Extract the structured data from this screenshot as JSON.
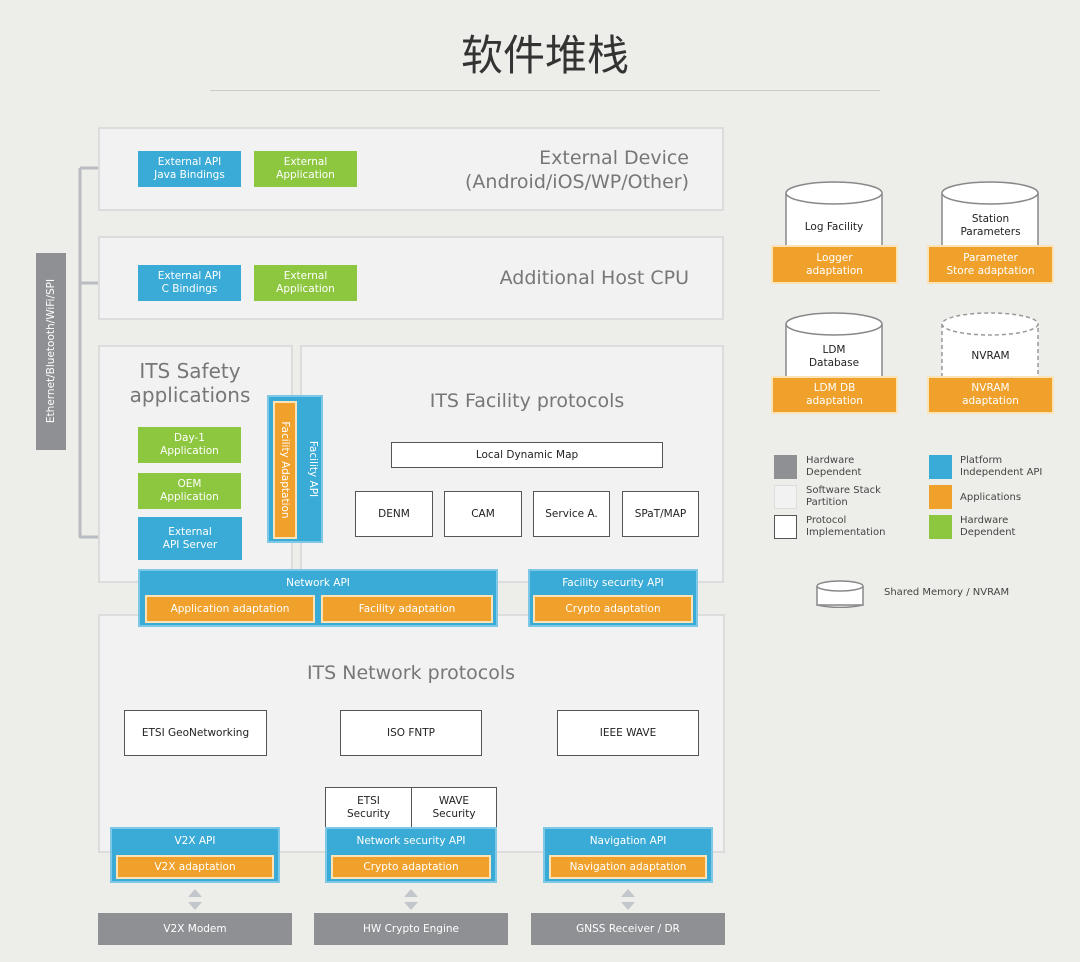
{
  "title": "软件堆栈",
  "side_bar": "Ethernet/Bluetooth/WiFi/SPI",
  "external_device": {
    "title1": "External Device",
    "title2": "(Android/iOS/WP/Other)",
    "api": [
      "External API",
      "Java Bindings"
    ],
    "app": [
      "External",
      "Application"
    ]
  },
  "host_cpu": {
    "title": "Additional Host CPU",
    "api": [
      "External API",
      "C Bindings"
    ],
    "app": [
      "External",
      "Application"
    ]
  },
  "safety": {
    "title1": "ITS Safety",
    "title2": "applications",
    "day1": [
      "Day-1",
      "Application"
    ],
    "oem": [
      "OEM",
      "Application"
    ],
    "server": [
      "External",
      "API Server"
    ]
  },
  "facility": {
    "title": "ITS Facility protocols",
    "api": "Facility API",
    "adaptation": "Facility Adaptation",
    "ldm": "Local Dynamic Map",
    "protocols": [
      "DENM",
      "CAM",
      "Service A.",
      "SPaT/MAP"
    ]
  },
  "network_api": {
    "label": "Network API",
    "items": [
      "Application adaptation",
      "Facility adaptation"
    ]
  },
  "facility_security_api": {
    "label": "Facility security API",
    "item": "Crypto adaptation"
  },
  "network": {
    "title": "ITS Network protocols",
    "protocols": [
      "ETSI GeoNetworking",
      "ISO FNTP",
      "IEEE WAVE"
    ],
    "etsi_sec": [
      "ETSI",
      "Security"
    ],
    "wave_sec": [
      "WAVE",
      "Security"
    ]
  },
  "bottom_apis": [
    {
      "label": "V2X API",
      "item": "V2X adaptation",
      "hw": "V2X Modem"
    },
    {
      "label": "Network security API",
      "item": "Crypto adaptation",
      "hw": "HW Crypto Engine"
    },
    {
      "label": "Navigation API",
      "item": "Navigation adaptation",
      "hw": "GNSS Receiver / DR"
    }
  ],
  "storage": [
    {
      "name": [
        "Log Facility"
      ],
      "adapt": [
        "Logger",
        "adaptation"
      ]
    },
    {
      "name": [
        "Station",
        "Parameters"
      ],
      "adapt": [
        "Parameter",
        "Store adaptation"
      ]
    },
    {
      "name": [
        "LDM",
        "Database"
      ],
      "adapt": [
        "LDM DB",
        "adaptation"
      ]
    },
    {
      "name": [
        "NVRAM"
      ],
      "adapt": [
        "NVRAM",
        "adaptation"
      ]
    }
  ],
  "legend": {
    "items": [
      {
        "label": [
          "Hardware",
          "Dependent"
        ],
        "color": "#8f9094"
      },
      {
        "label": [
          "Software Stack",
          "Partition"
        ],
        "color": "#f2f2f2"
      },
      {
        "label": [
          "Protocol",
          "Implementation"
        ],
        "color": "#ffffff"
      },
      {
        "label": [
          "Platform",
          "Independent API"
        ],
        "color": "#3aabd6"
      },
      {
        "label": [
          "",
          "Applications"
        ],
        "color": "#f0a12b"
      },
      {
        "label": [
          "Hardware",
          "Dependent"
        ],
        "color": "#8dc63f"
      }
    ],
    "shared": "Shared Memory / NVRAM"
  }
}
